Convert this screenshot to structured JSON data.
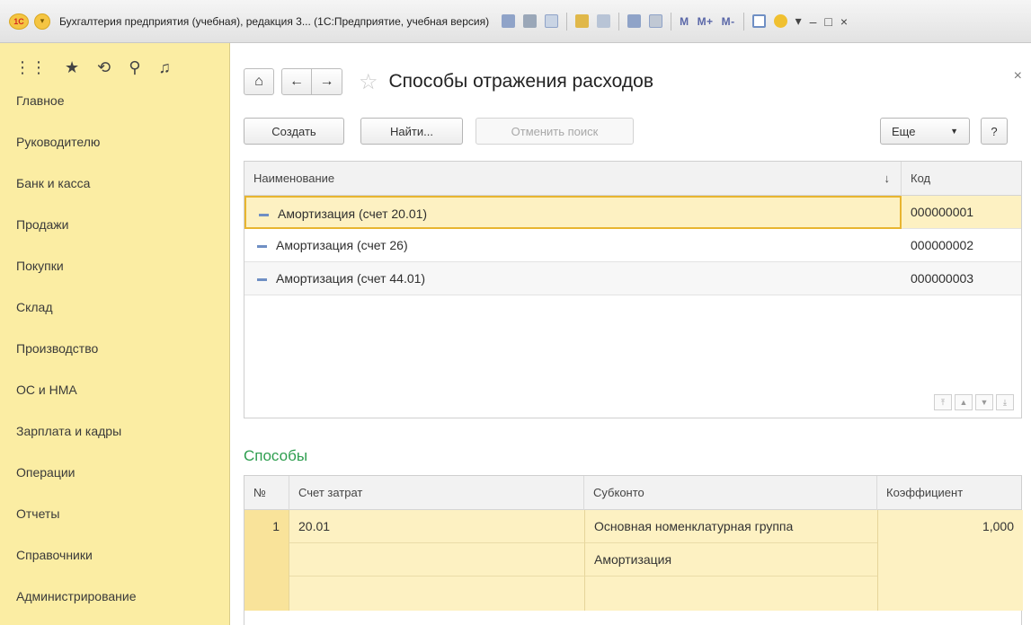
{
  "window": {
    "title": "Бухгалтерия предприятия (учебная), редакция 3... (1С:Предприятие, учебная версия)",
    "logo": "1С",
    "m_buttons": [
      "M",
      "M+",
      "M-"
    ]
  },
  "sidebar": {
    "items": [
      {
        "label": "Главное"
      },
      {
        "label": "Руководителю"
      },
      {
        "label": "Банк и касса"
      },
      {
        "label": "Продажи"
      },
      {
        "label": "Покупки"
      },
      {
        "label": "Склад"
      },
      {
        "label": "Производство"
      },
      {
        "label": "ОС и НМА"
      },
      {
        "label": "Зарплата и кадры"
      },
      {
        "label": "Операции"
      },
      {
        "label": "Отчеты"
      },
      {
        "label": "Справочники"
      },
      {
        "label": "Администрирование"
      }
    ]
  },
  "page": {
    "title": "Способы отражения расходов"
  },
  "toolbar": {
    "create": "Создать",
    "find": "Найти...",
    "cancel_search": "Отменить поиск",
    "more": "Еще",
    "help": "?"
  },
  "list": {
    "columns": {
      "name": "Наименование",
      "code": "Код"
    },
    "rows": [
      {
        "name": "Амортизация (счет 20.01)",
        "code": "000000001",
        "selected": true
      },
      {
        "name": "Амортизация (счет 26)",
        "code": "000000002",
        "selected": false
      },
      {
        "name": "Амортизация (счет 44.01)",
        "code": "000000003",
        "selected": false
      }
    ]
  },
  "methods": {
    "title": "Способы",
    "columns": {
      "num": "№",
      "account": "Счет затрат",
      "subconto": "Субконто",
      "coef": "Коэффициент"
    },
    "rows": [
      {
        "num": "1",
        "account": "20.01",
        "subconto1": "Основная номенклатурная группа",
        "subconto2": "Амортизация",
        "coef": "1,000"
      }
    ]
  },
  "colors": {
    "sidebar_bg": "#fbeda3",
    "selected_row": "#fdf1c2",
    "selected_border": "#e8b530",
    "section_title": "#2e9e4f"
  }
}
